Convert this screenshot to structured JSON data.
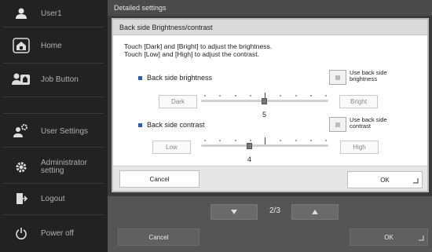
{
  "sidebar": {
    "user": "User1",
    "items": [
      {
        "label": "Home",
        "icon": "home-icon"
      },
      {
        "label": "Job Button",
        "icon": "job-button-icon"
      },
      {
        "label": "User Settings",
        "icon": "user-settings-icon"
      },
      {
        "label": "Administrator\nsetting",
        "label_line1": "Administrator",
        "label_line2": "setting",
        "icon": "gear-icon"
      },
      {
        "label": "Logout",
        "icon": "logout-icon"
      },
      {
        "label": "Power off",
        "icon": "power-icon"
      }
    ]
  },
  "main": {
    "header": "Detailed settings",
    "pager": {
      "page": "2/3",
      "prev_icon": "triangle-down-icon",
      "next_icon": "triangle-up-icon"
    },
    "bottom": {
      "cancel": "Cancel",
      "ok": "OK"
    }
  },
  "dialog": {
    "title": "Back side Brightness/contrast",
    "instruction_line1": "Touch [Dark] and [Bright] to adjust the brightness.",
    "instruction_line2": "Touch [Low] and [High] to adjust the contrast.",
    "brightness": {
      "label": "Back side brightness",
      "use_label_line1": "Use back side",
      "use_label_line2": "brightness",
      "left_btn": "Dark",
      "right_btn": "Bright",
      "value": "5",
      "min": 1,
      "max": 9
    },
    "contrast": {
      "label": "Back side contrast",
      "use_label_line1": "Use back side",
      "use_label_line2": "contrast",
      "left_btn": "Low",
      "right_btn": "High",
      "value": "4",
      "min": 1,
      "max": 9
    },
    "cancel": "Cancel",
    "ok": "OK"
  },
  "colors": {
    "accent": "#2a5db0",
    "sidebar_bg": "#222222",
    "dialog_title_bg": "#dadada"
  }
}
